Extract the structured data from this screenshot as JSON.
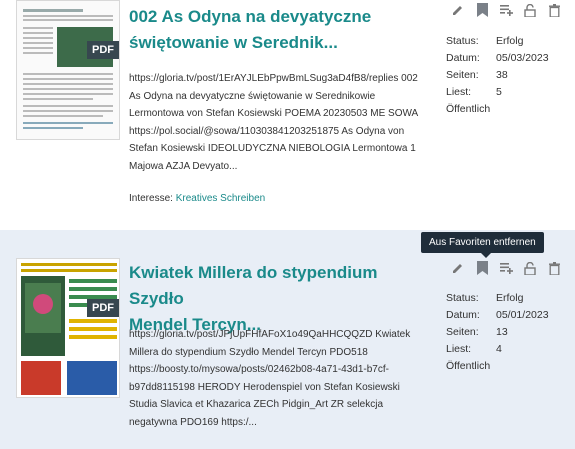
{
  "items": [
    {
      "title_line1": "002 As Odyna na devyatyczne",
      "title_line2": "świętowanie w Serednik...",
      "pdf_label": "PDF",
      "description": "https://gloria.tv/post/1ErAYJLEbPpwBmLSug3aD4fB8/replies 002 As Odyna na devyatyczne świętowanie w Serednikowie Lermontowa von Stefan Kosiewski POEMA 20230503 ME SOWA https://pol.social/@sowa/110303841203251875 As Odyna von Stefan Kosiewski IDEOLUDYCZNA NIEBOLOGIA Lermontowa 1 Majowa AZJA Devyato...",
      "interest_label": "Interesse:",
      "interest_value": "Kreatives Schreiben",
      "status_label": "Status:",
      "status_value": "Erfolg",
      "date_label": "Datum:",
      "date_value": "05/03/2023",
      "pages_label": "Seiten:",
      "pages_value": "38",
      "reads_label": "Liest:",
      "reads_value": "5",
      "visibility": "Öffentlich"
    },
    {
      "title_line1": "Kwiatek Millera do stypendium Szydło",
      "title_line2": "Mendel Tercyn...",
      "pdf_label": "PDF",
      "description": "https://gloria.tv/post/JPjUpFHfAFoX1o49QaHHCQQZD Kwiatek Millera do stypendium Szydło Mendel Tercyn PDO518 https://boosty.to/mysowa/posts/02462b08-4a71-43d1-b7cf-b97dd8115198 HERODY Herodenspiel von Stefan Kosiewski Studia Slavica et Khazarica ZECh Pidgin_Art ZR selekcja negatywna PDO169 https:/...",
      "status_label": "Status:",
      "status_value": "Erfolg",
      "date_label": "Datum:",
      "date_value": "05/01/2023",
      "pages_label": "Seiten:",
      "pages_value": "13",
      "reads_label": "Liest:",
      "reads_value": "4",
      "visibility": "Öffentlich"
    }
  ],
  "tooltip": "Aus Favoriten entfernen",
  "icons": [
    "pencil-icon",
    "bookmark-icon",
    "playlist-add-icon",
    "unlock-icon",
    "trash-icon"
  ],
  "colors": {
    "accent": "#1a8a8a",
    "highlight_bg": "#e8eef6",
    "tooltip_bg": "#1f2d3a"
  }
}
